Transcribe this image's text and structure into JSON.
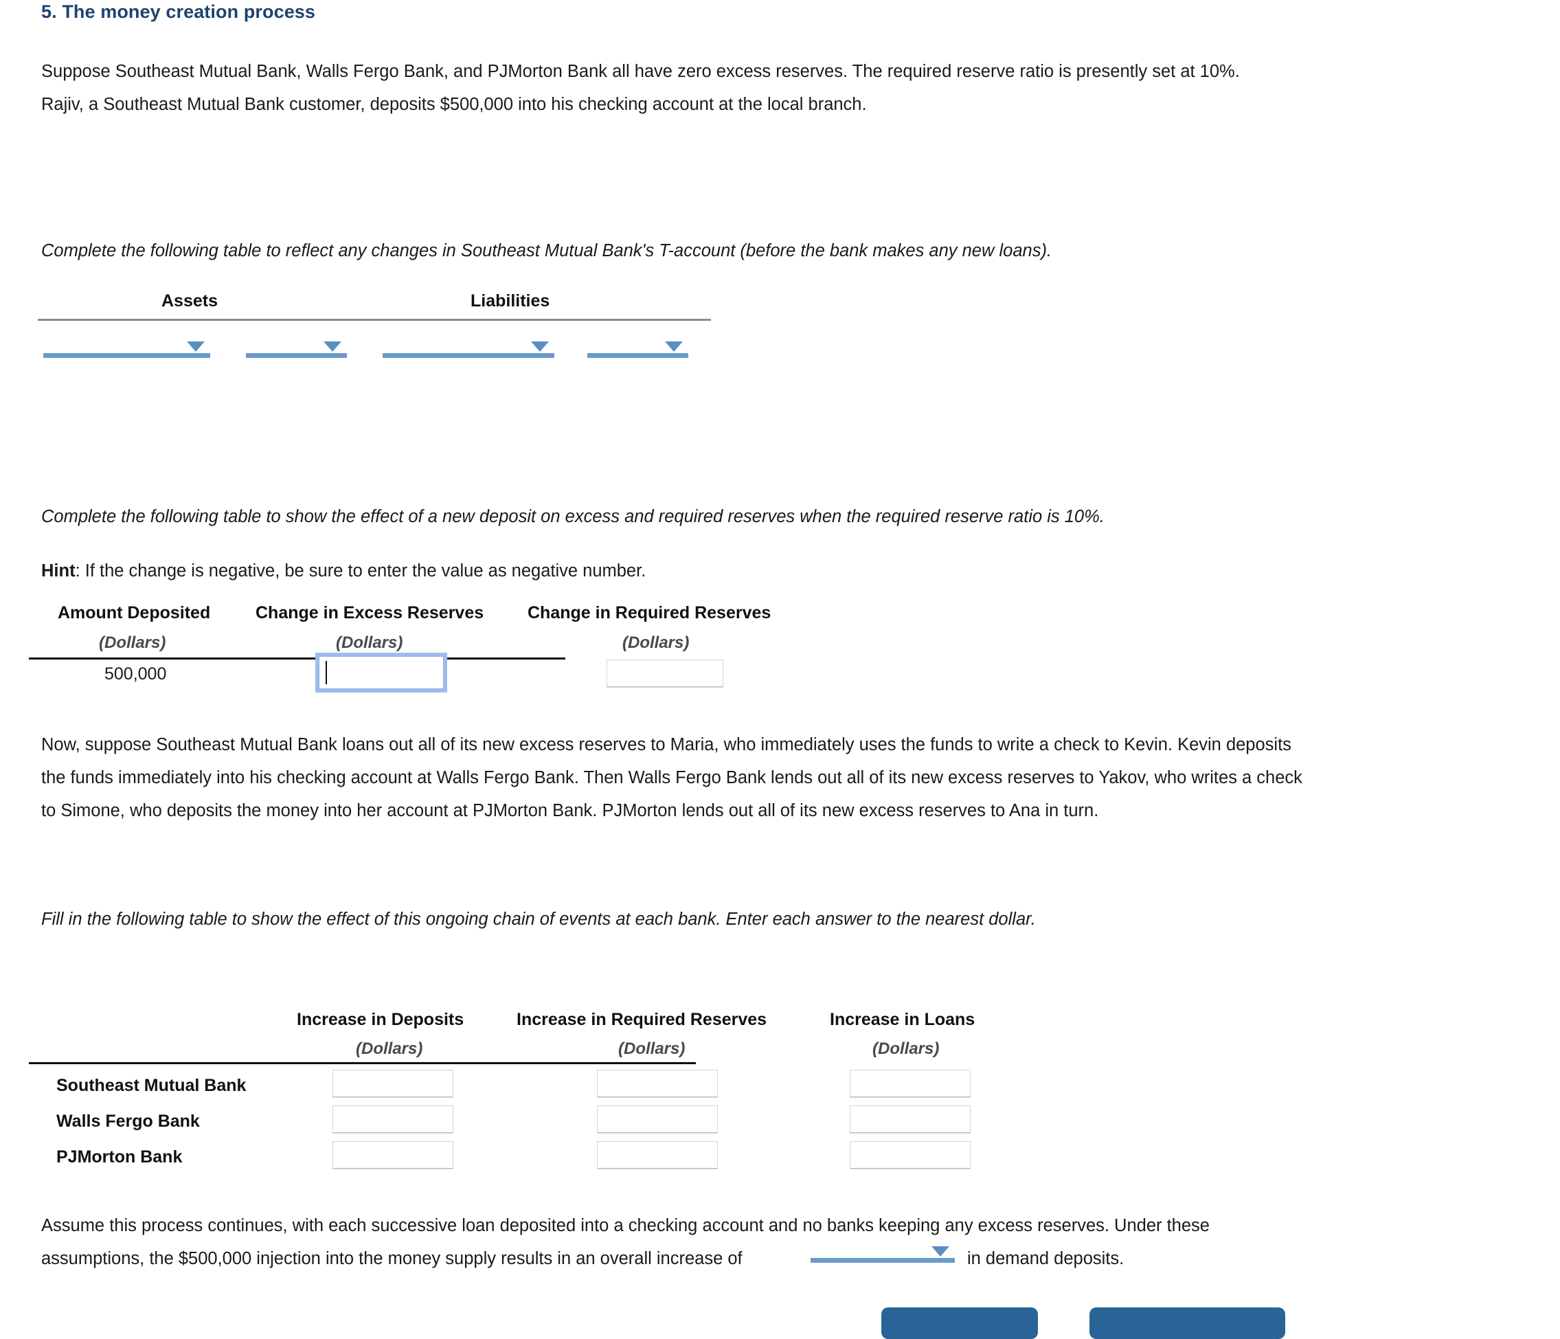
{
  "question": {
    "number_title": "5. The money creation process",
    "intro": "Suppose Southeast Mutual Bank, Walls Fergo Bank, and PJMorton Bank all have zero excess reserves. The required reserve ratio is presently set at 10%. Rajiv, a Southeast Mutual Bank customer, deposits $500,000 into his checking account at the local branch."
  },
  "taccount": {
    "instruction": "Complete the following table to reflect any changes in Southeast Mutual Bank's T-account (before the bank makes any new loans).",
    "col_assets": "Assets",
    "col_liabilities": "Liabilities",
    "dropdowns": [
      {
        "name": "assets-item-dropdown",
        "value": ""
      },
      {
        "name": "assets-amount-dropdown",
        "value": ""
      },
      {
        "name": "liabilities-item-dropdown",
        "value": ""
      },
      {
        "name": "liabilities-amount-dropdown",
        "value": ""
      }
    ]
  },
  "reserves_table": {
    "instruction": "Complete the following table to show the effect of a new deposit on excess and required reserves when the required reserve ratio is 10%.",
    "hint_label": "Hint",
    "hint_text": ": If the change is negative, be sure to enter the value as negative number.",
    "headers": [
      "Amount Deposited",
      "Change in Excess Reserves",
      "Change in Required Reserves"
    ],
    "subheaders": [
      "(Dollars)",
      "(Dollars)",
      "(Dollars)"
    ],
    "row": {
      "amount_deposited": "500,000",
      "change_excess_reserves": "",
      "change_required_reserves": ""
    }
  },
  "chain_paragraph": "Now, suppose Southeast Mutual Bank loans out all of its new excess reserves to Maria, who immediately uses the funds to write a check to Kevin. Kevin deposits the funds immediately into his checking account at Walls Fergo Bank. Then Walls Fergo Bank lends out all of its new excess reserves to Yakov, who writes a check to Simone, who deposits the money into her account at PJMorton Bank. PJMorton lends out all of its new excess reserves to Ana in turn.",
  "bank_table": {
    "instruction": "Fill in the following table to show the effect of this ongoing chain of events at each bank. Enter each answer to the nearest dollar.",
    "headers": [
      "Increase in Deposits",
      "Increase in Required Reserves",
      "Increase in Loans"
    ],
    "subheaders": [
      "(Dollars)",
      "(Dollars)",
      "(Dollars)"
    ],
    "rows": [
      {
        "bank": "Southeast Mutual Bank",
        "deposits": "",
        "required_reserves": "",
        "loans": ""
      },
      {
        "bank": "Walls Fergo Bank",
        "deposits": "",
        "required_reserves": "",
        "loans": ""
      },
      {
        "bank": "PJMorton Bank",
        "deposits": "",
        "required_reserves": "",
        "loans": ""
      }
    ]
  },
  "conclusion": {
    "part1": "Assume this process continues, with each successive loan deposited into a checking account and no banks keeping any excess reserves. Under these",
    "part2": "assumptions, the $500,000 injection into the money supply results in an overall increase of",
    "dropdown_value": "",
    "part3": "in demand deposits."
  },
  "footer_buttons": [
    {
      "name": "grade-it-now-button",
      "label": ""
    },
    {
      "name": "save-continue-button",
      "label": ""
    }
  ],
  "colors": {
    "title": "#1d4370",
    "dropdown_blue": "#6a9ac9",
    "button_blue": "#2a6496",
    "focus_blue": "#9cbcec",
    "rule_gray": "#8c8c8c",
    "rule_black": "#0f0f0f"
  }
}
